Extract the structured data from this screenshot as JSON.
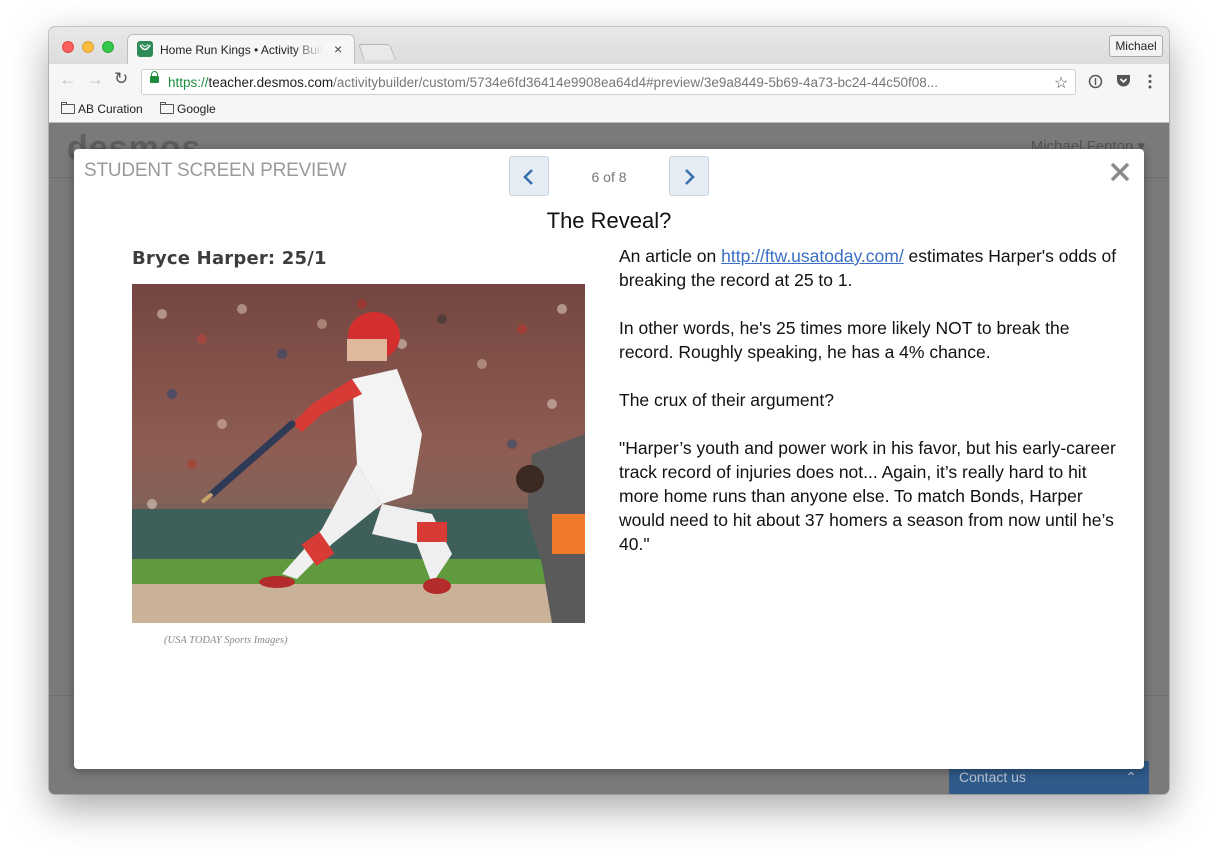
{
  "browser": {
    "tab_title": "Home Run Kings • Activity Builder",
    "tab_close": "×",
    "profile_name": "Michael",
    "url_scheme": "https://",
    "url_host": "teacher.desmos.com",
    "url_path": "/activitybuilder/custom/5734e6fd36414e9908ea64d4#preview/3e9a8449-5b69-4a73-bc24-44c50f08...",
    "back_glyph": "←",
    "forward_glyph": "→",
    "reload_glyph": "↻",
    "star_glyph": "☆",
    "bookmarks": [
      "AB Curation",
      "Google"
    ]
  },
  "page": {
    "logo": "desmos",
    "user": "Michael Fenton ▾",
    "contact_label": "Contact us",
    "contact_caret": "⌃"
  },
  "modal": {
    "heading": "STUDENT SCREEN PREVIEW",
    "page_count": "6 of 8",
    "screen_title": "The Reveal?",
    "left_heading": "Bryce Harper: 25/1",
    "photo_caption": "(USA TODAY Sports Images)",
    "article": {
      "p1_before": "An article on ",
      "p1_link": "http://ftw.usatoday.com/",
      "p1_after": " estimates Harper's odds of breaking the record at 25 to 1.",
      "p2": "In other words, he's 25 times more likely NOT to break the record. Roughly speaking, he has a 4% chance.",
      "p3": "The crux of their argument?",
      "p4": "\"Harper’s youth and power work in his favor, but his early-career track record of injuries does not... Again, it’s really hard to hit more home runs than anyone else. To match Bonds, Harper would need to hit about 37 homers a season from now until he’s 40.\""
    }
  },
  "colors": {
    "accent_link": "#3a6fc4",
    "pager_bg": "#e6ecf3",
    "overlay": "#7a7a7a",
    "contact_bg": "#2f5a8a"
  }
}
